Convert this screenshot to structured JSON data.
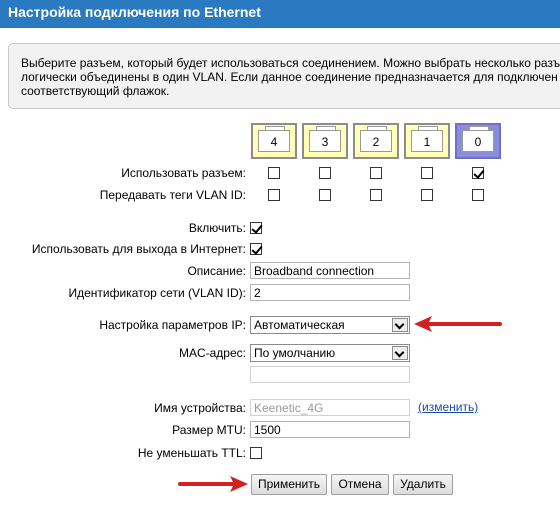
{
  "header": {
    "title": "Настройка подключения по Ethernet"
  },
  "info": {
    "lines": [
      "Выберите разъем, который будет использоваться соединением. Можно выбрать несколько разъ",
      "логически объединены в один VLAN. Если данное соединение предназначается для подключен",
      "соответствующий флажок."
    ]
  },
  "ports": [
    {
      "label": "4",
      "use": false,
      "vlan_tag": false,
      "selected": false
    },
    {
      "label": "3",
      "use": false,
      "vlan_tag": false,
      "selected": false
    },
    {
      "label": "2",
      "use": false,
      "vlan_tag": false,
      "selected": false
    },
    {
      "label": "1",
      "use": false,
      "vlan_tag": false,
      "selected": false
    },
    {
      "label": "0",
      "use": true,
      "vlan_tag": false,
      "selected": true
    }
  ],
  "rows": {
    "use_port_label": "Использовать разъем:",
    "vlan_tags_label": "Передавать теги VLAN ID:"
  },
  "form": {
    "enable": {
      "label": "Включить:",
      "checked": true
    },
    "internet": {
      "label": "Использовать для выхода в Интернет:",
      "checked": true
    },
    "description": {
      "label": "Описание:",
      "value": "Broadband connection"
    },
    "vlan_id": {
      "label": "Идентификатор сети (VLAN ID):",
      "value": "2"
    },
    "ip_settings": {
      "label": "Настройка параметров IP:",
      "value": "Автоматическая"
    },
    "mac": {
      "label": "MAC-адрес:",
      "value": "По умолчанию",
      "extra_value": ""
    },
    "device_name": {
      "label": "Имя устройства:",
      "value": "Keenetic_4G",
      "change_link": "(изменить)"
    },
    "mtu": {
      "label": "Размер MTU:",
      "value": "1500"
    },
    "ttl": {
      "label": "Не уменьшать TTL:",
      "checked": false
    }
  },
  "buttons": {
    "apply": "Применить",
    "cancel": "Отмена",
    "delete": "Удалить"
  },
  "colors": {
    "header": "#2a7ac2",
    "port": "#ffffb8",
    "port_selected": "#8c8cdc",
    "arrow": "#d42020",
    "link": "#1a4aa8"
  }
}
